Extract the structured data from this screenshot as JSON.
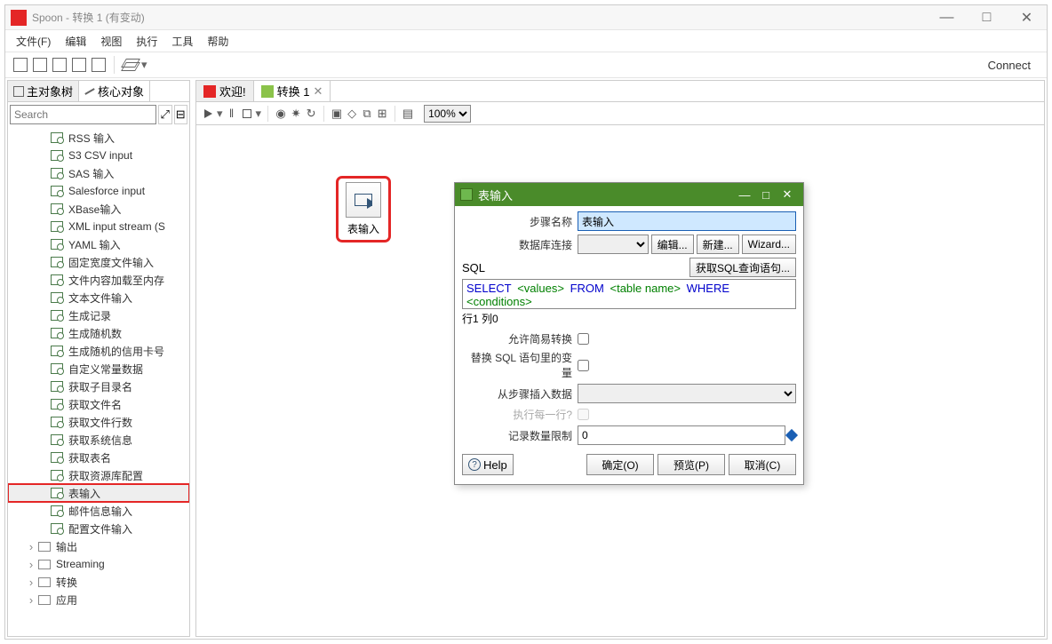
{
  "window": {
    "title": "Spoon - 转换 1 (有变动)"
  },
  "win_btns": {
    "min": "—",
    "max": "□",
    "close": "✕"
  },
  "menu": {
    "file": "文件(F)",
    "edit": "编辑",
    "view": "视图",
    "run": "执行",
    "tools": "工具",
    "help": "帮助"
  },
  "toolbar": {
    "connect": "Connect"
  },
  "sidebar": {
    "tabs": {
      "main": "主对象树",
      "core": "核心对象"
    },
    "search_placeholder": "Search",
    "items": [
      "RSS 输入",
      "S3 CSV input",
      "SAS 输入",
      "Salesforce input",
      "XBase输入",
      "XML input stream (S",
      "YAML 输入",
      "固定宽度文件输入",
      "文件内容加载至内存",
      "文本文件输入",
      "生成记录",
      "生成随机数",
      "生成随机的信用卡号",
      "自定义常量数据",
      "获取子目录名",
      "获取文件名",
      "获取文件行数",
      "获取系统信息",
      "获取表名",
      "获取资源库配置",
      "表输入",
      "邮件信息输入",
      "配置文件输入"
    ],
    "highlight_index": 20,
    "folders": [
      "输出",
      "Streaming",
      "转换",
      "应用"
    ]
  },
  "canvas": {
    "tabs": {
      "welcome": "欢迎!",
      "trans": "转换 1"
    },
    "zoom": "100%",
    "step_label": "表输入"
  },
  "dialog": {
    "title": "表输入",
    "labels": {
      "step_name": "步骤名称",
      "db_conn": "数据库连接",
      "edit": "编辑...",
      "new": "新建...",
      "wizard": "Wizard...",
      "sql": "SQL",
      "get_sql": "获取SQL查询语句...",
      "cursor": "行1 列0",
      "allow_lazy": "允许简易转换",
      "replace_var": "替换 SQL 语句里的变量",
      "insert_from": "从步骤插入数据",
      "exec_each": "执行每一行?",
      "limit": "记录数量限制",
      "help": "Help",
      "ok": "确定(O)",
      "preview": "预览(P)",
      "cancel": "取消(C)"
    },
    "step_name_value": "表输入",
    "limit_value": "0",
    "sql": {
      "select": "SELECT",
      "values": "<values>",
      "from": "FROM",
      "table": "<table name>",
      "where": "WHERE",
      "cond": "<conditions>"
    }
  }
}
